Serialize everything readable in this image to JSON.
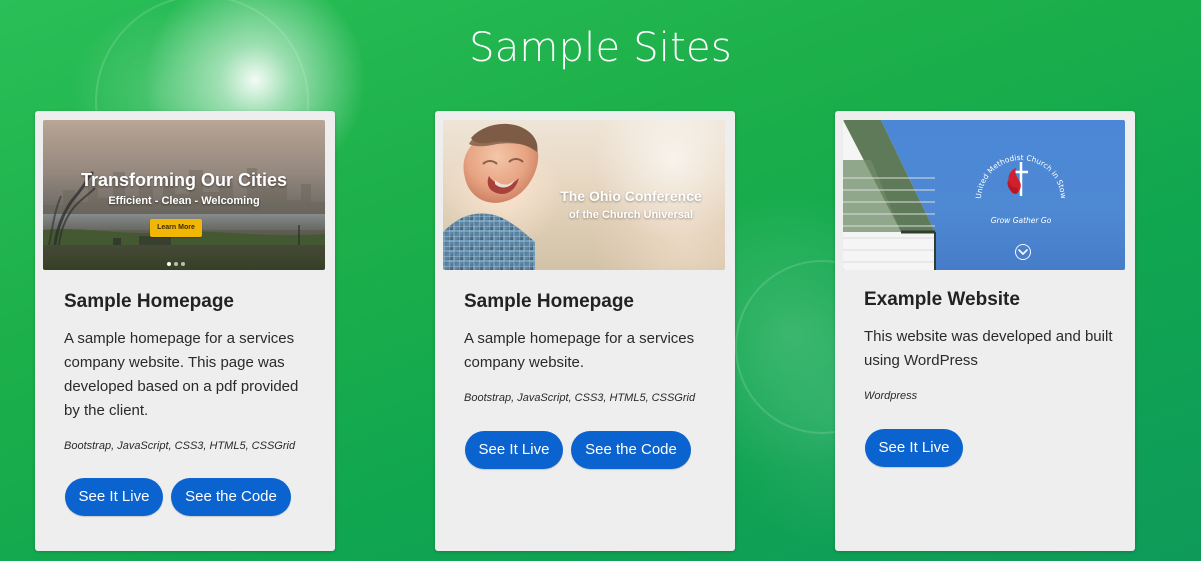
{
  "page": {
    "title": "Sample Sites"
  },
  "cards": [
    {
      "thumbnail": {
        "headline": "Transforming Our Cities",
        "tagline": "Efficient - Clean - Welcoming",
        "button_label": "Learn More",
        "carousel": {
          "dot_count": 3,
          "active_index": 0
        }
      },
      "title": "Sample Homepage",
      "description": "A sample homepage for a services company website. This page was developed based on a pdf provided by the client.",
      "tech": "Bootstrap, JavaScript, CSS3, HTML5, CSSGrid",
      "buttons": {
        "live": "See It Live",
        "code": "See the Code"
      }
    },
    {
      "thumbnail": {
        "headline": "The Ohio Conference",
        "subline": "of the Church Universal"
      },
      "title": "Sample Homepage",
      "description": "A sample homepage for a services company website.",
      "tech": "Bootstrap, JavaScript, CSS3, HTML5, CSSGrid",
      "buttons": {
        "live": "See It Live",
        "code": "See the Code"
      }
    },
    {
      "thumbnail": {
        "seal_arc_text": "United Methodist Church in Stow",
        "seal_motto": "Grow  Gather  Go"
      },
      "title": "Example Website",
      "description": "This website was developed and built using WordPress",
      "tech": "Wordpress",
      "buttons": {
        "live": "See It Live"
      }
    }
  ],
  "colors": {
    "background_green": "#1db04a",
    "card_background": "#eeeeee",
    "button_blue": "#0b63cf",
    "text_dark": "#222222",
    "learn_more_yellow": "#f2b705",
    "methodist_red": "#d01f2f"
  },
  "icons": {
    "chevron": "chevron-down-circle-icon"
  }
}
